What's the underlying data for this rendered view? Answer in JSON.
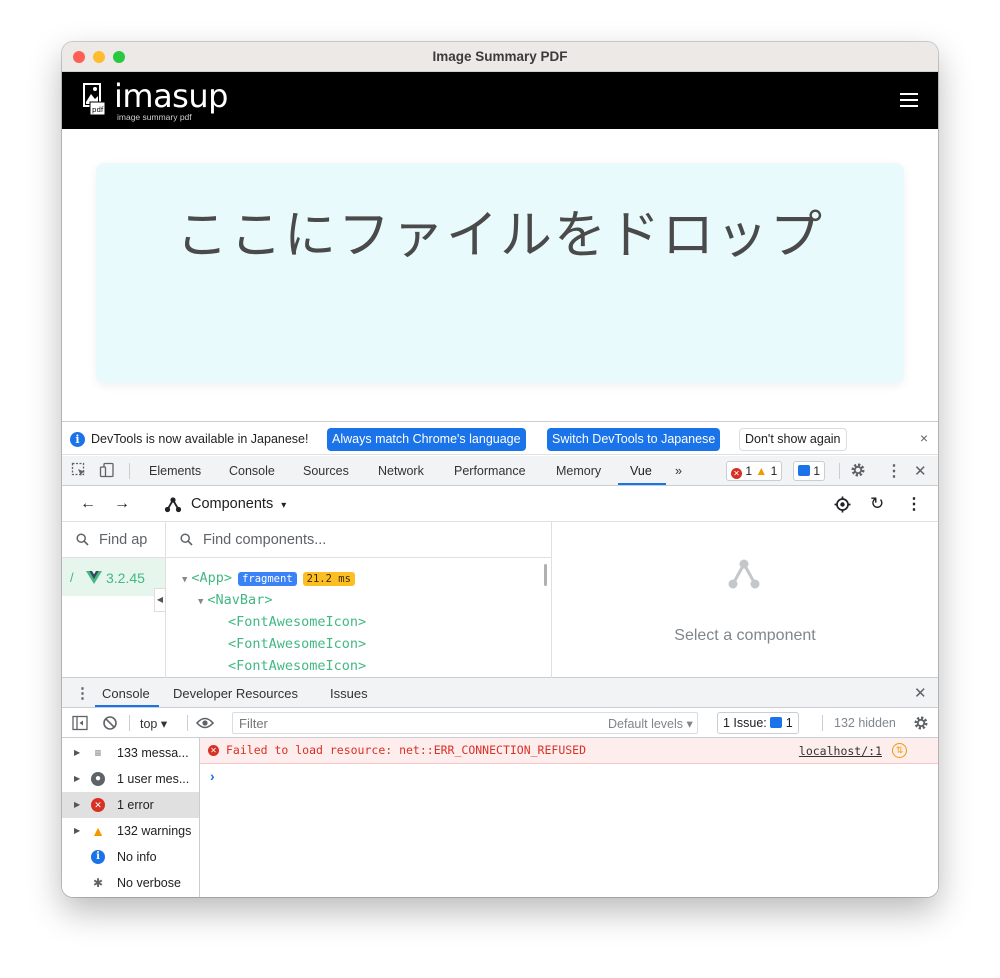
{
  "window": {
    "title": "Image Summary PDF"
  },
  "navbar": {
    "logo_text": "imasup",
    "logo_subtitle": "image summary pdf",
    "logo_badge": "pdf"
  },
  "dropzone": {
    "text": "ここにファイルをドロップ"
  },
  "devtools": {
    "infobar": {
      "message": "DevTools is now available in Japanese!",
      "btn_match": "Always match Chrome's language",
      "btn_switch": "Switch DevTools to Japanese",
      "btn_dismiss": "Don't show again",
      "close": "×"
    },
    "tabs": [
      "Elements",
      "Console",
      "Sources",
      "Network",
      "Performance",
      "Memory",
      "Vue"
    ],
    "more_tabs": "»",
    "counts": {
      "errors": "1",
      "warnings": "1",
      "messages": "1"
    },
    "close": "✕",
    "components_label": "Components",
    "find_app_placeholder": "Find ap",
    "find_components_placeholder": "Find components...",
    "app_version": "3.2.45",
    "app_prefix": "/",
    "tree": {
      "root": "<App>",
      "fragment": "fragment",
      "time": "21.2 ms",
      "navbar": "<NavBar>",
      "children": [
        "<FontAwesomeIcon>",
        "<FontAwesomeIcon>",
        "<FontAwesomeIcon>"
      ]
    },
    "select_hint": "Select a component",
    "drawer_tabs": [
      "Console",
      "Developer Resources",
      "Issues"
    ],
    "console_toolbar": {
      "context": "top ▾",
      "filter_placeholder": "Filter",
      "levels": "Default levels ▾",
      "issue_label": "1 Issue:",
      "issue_count": "1",
      "hidden": "132 hidden"
    },
    "sidebar": [
      {
        "label": "133 messa...",
        "icon": "list-icon"
      },
      {
        "label": "1 user mes...",
        "icon": "user-icon"
      },
      {
        "label": "1 error",
        "icon": "error-icon"
      },
      {
        "label": "132 warnings",
        "icon": "warning-icon"
      },
      {
        "label": "No info",
        "icon": "info-icon"
      },
      {
        "label": "No verbose",
        "icon": "bug-icon"
      }
    ],
    "error_message": "Failed to load resource: net::ERR_CONNECTION_REFUSED",
    "error_source": "localhost/:1",
    "prompt": "›"
  },
  "colors": {
    "vue_green": "#42b883",
    "accent_blue": "#1a73e8",
    "error_red": "#d93025",
    "dropzone_bg": "#e8fafb"
  }
}
